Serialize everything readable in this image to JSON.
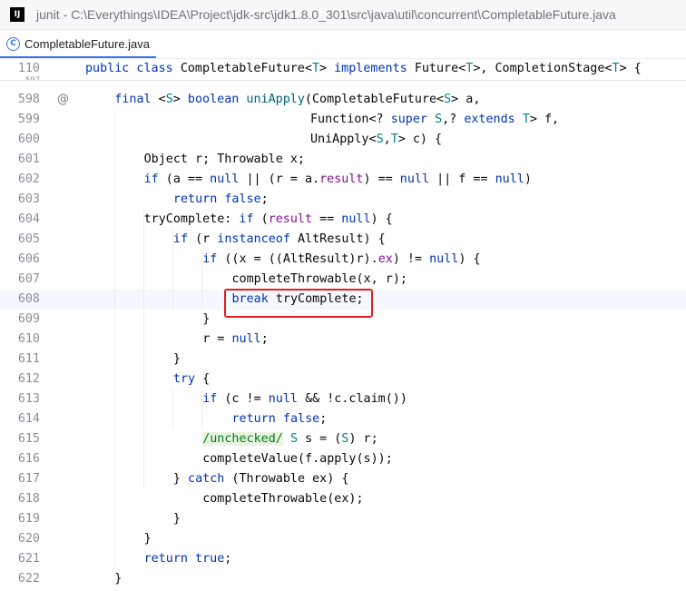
{
  "window": {
    "app_icon_text": "IJ",
    "title": "junit - C:\\Everythings\\IDEA\\Project\\jdk-src\\jdk1.8.0_301\\src\\java\\util\\concurrent\\CompletableFuture.java"
  },
  "tab": {
    "icon_text": "C",
    "label": "CompletableFuture.java"
  },
  "sticky_header": {
    "line_number": "110",
    "cut_line_number": "597",
    "tokens": [
      {
        "t": "public class ",
        "c": "kw"
      },
      {
        "t": "CompletableFuture<",
        "c": ""
      },
      {
        "t": "T",
        "c": "tp"
      },
      {
        "t": "> ",
        "c": ""
      },
      {
        "t": "implements ",
        "c": "kw"
      },
      {
        "t": "Future<",
        "c": ""
      },
      {
        "t": "T",
        "c": "tp"
      },
      {
        "t": ">, CompletionStage<",
        "c": ""
      },
      {
        "t": "T",
        "c": "tp"
      },
      {
        "t": "> {",
        "c": ""
      }
    ]
  },
  "gutter": {
    "annotation_icon": "@",
    "annotation_line": "598"
  },
  "lines": [
    {
      "num": "598",
      "indent": 1,
      "tokens": [
        {
          "t": "final ",
          "c": "kw"
        },
        {
          "t": "<",
          "c": ""
        },
        {
          "t": "S",
          "c": "tp"
        },
        {
          "t": "> ",
          "c": ""
        },
        {
          "t": "boolean ",
          "c": "kw"
        },
        {
          "t": "uniApply",
          "c": "fn"
        },
        {
          "t": "(CompletableFuture<",
          "c": ""
        },
        {
          "t": "S",
          "c": "tp"
        },
        {
          "t": "> a,",
          "c": ""
        }
      ]
    },
    {
      "num": "599",
      "indent": 0,
      "pad": 342,
      "tokens": [
        {
          "t": "Function<? ",
          "c": ""
        },
        {
          "t": "super ",
          "c": "kw"
        },
        {
          "t": "S",
          "c": "tp"
        },
        {
          "t": ",? ",
          "c": ""
        },
        {
          "t": "extends ",
          "c": "kw"
        },
        {
          "t": "T",
          "c": "tp"
        },
        {
          "t": "> f,",
          "c": ""
        }
      ]
    },
    {
      "num": "600",
      "indent": 0,
      "pad": 342,
      "tokens": [
        {
          "t": "UniApply<",
          "c": ""
        },
        {
          "t": "S",
          "c": "tp"
        },
        {
          "t": ",",
          "c": ""
        },
        {
          "t": "T",
          "c": "tp"
        },
        {
          "t": "> c) {",
          "c": ""
        }
      ]
    },
    {
      "num": "601",
      "indent": 2,
      "tokens": [
        {
          "t": "Object r; Throwable x;",
          "c": ""
        }
      ]
    },
    {
      "num": "602",
      "indent": 2,
      "tokens": [
        {
          "t": "if ",
          "c": "kw"
        },
        {
          "t": "(a == ",
          "c": ""
        },
        {
          "t": "null ",
          "c": "kw"
        },
        {
          "t": "|| (r = a.",
          "c": ""
        },
        {
          "t": "result",
          "c": "fld"
        },
        {
          "t": ") == ",
          "c": ""
        },
        {
          "t": "null ",
          "c": "kw"
        },
        {
          "t": "|| f == ",
          "c": ""
        },
        {
          "t": "null",
          "c": "kw"
        },
        {
          "t": ")",
          "c": ""
        }
      ]
    },
    {
      "num": "603",
      "indent": 3,
      "tokens": [
        {
          "t": "return false",
          "c": "kw"
        },
        {
          "t": ";",
          "c": ""
        }
      ]
    },
    {
      "num": "604",
      "indent": 2,
      "tokens": [
        {
          "t": "tryComplete: ",
          "c": ""
        },
        {
          "t": "if ",
          "c": "kw"
        },
        {
          "t": "(",
          "c": ""
        },
        {
          "t": "result",
          "c": "fld"
        },
        {
          "t": " == ",
          "c": ""
        },
        {
          "t": "null",
          "c": "kw"
        },
        {
          "t": ") {",
          "c": ""
        }
      ]
    },
    {
      "num": "605",
      "indent": 3,
      "tokens": [
        {
          "t": "if ",
          "c": "kw"
        },
        {
          "t": "(r ",
          "c": ""
        },
        {
          "t": "instanceof ",
          "c": "kw"
        },
        {
          "t": "AltResult) {",
          "c": ""
        }
      ]
    },
    {
      "num": "606",
      "indent": 4,
      "tokens": [
        {
          "t": "if ",
          "c": "kw"
        },
        {
          "t": "((x = ((AltResult)r).",
          "c": ""
        },
        {
          "t": "ex",
          "c": "fld"
        },
        {
          "t": ") != ",
          "c": ""
        },
        {
          "t": "null",
          "c": "kw"
        },
        {
          "t": ") {",
          "c": ""
        }
      ]
    },
    {
      "num": "607",
      "indent": 5,
      "tokens": [
        {
          "t": "completeThrowable(x, r);",
          "c": ""
        }
      ]
    },
    {
      "num": "608",
      "indent": 5,
      "current": true,
      "tokens": [
        {
          "t": "break ",
          "c": "kw"
        },
        {
          "t": "tryComplete;",
          "c": ""
        }
      ]
    },
    {
      "num": "609",
      "indent": 4,
      "tokens": [
        {
          "t": "}",
          "c": ""
        }
      ]
    },
    {
      "num": "610",
      "indent": 4,
      "tokens": [
        {
          "t": "r = ",
          "c": ""
        },
        {
          "t": "null",
          "c": "kw"
        },
        {
          "t": ";",
          "c": ""
        }
      ]
    },
    {
      "num": "611",
      "indent": 3,
      "tokens": [
        {
          "t": "}",
          "c": ""
        }
      ]
    },
    {
      "num": "612",
      "indent": 3,
      "tokens": [
        {
          "t": "try ",
          "c": "kw"
        },
        {
          "t": "{",
          "c": ""
        }
      ]
    },
    {
      "num": "613",
      "indent": 4,
      "tokens": [
        {
          "t": "if ",
          "c": "kw"
        },
        {
          "t": "(c != ",
          "c": ""
        },
        {
          "t": "null ",
          "c": "kw"
        },
        {
          "t": "&& !c.claim())",
          "c": ""
        }
      ]
    },
    {
      "num": "614",
      "indent": 5,
      "tokens": [
        {
          "t": "return false",
          "c": "kw"
        },
        {
          "t": ";",
          "c": ""
        }
      ]
    },
    {
      "num": "615",
      "indent": 4,
      "tokens": [
        {
          "t": "/unchecked/",
          "c": "comment-hl"
        },
        {
          "t": " ",
          "c": ""
        },
        {
          "t": "S",
          "c": "tp"
        },
        {
          "t": " s = (",
          "c": ""
        },
        {
          "t": "S",
          "c": "tp"
        },
        {
          "t": ") r;",
          "c": ""
        }
      ]
    },
    {
      "num": "616",
      "indent": 4,
      "tokens": [
        {
          "t": "completeValue(f.apply(s));",
          "c": ""
        }
      ]
    },
    {
      "num": "617",
      "indent": 3,
      "tokens": [
        {
          "t": "} ",
          "c": ""
        },
        {
          "t": "catch ",
          "c": "kw"
        },
        {
          "t": "(Throwable ex) {",
          "c": ""
        }
      ]
    },
    {
      "num": "618",
      "indent": 4,
      "tokens": [
        {
          "t": "completeThrowable(ex);",
          "c": ""
        }
      ]
    },
    {
      "num": "619",
      "indent": 3,
      "tokens": [
        {
          "t": "}",
          "c": ""
        }
      ]
    },
    {
      "num": "620",
      "indent": 2,
      "tokens": [
        {
          "t": "}",
          "c": ""
        }
      ]
    },
    {
      "num": "621",
      "indent": 2,
      "tokens": [
        {
          "t": "return true",
          "c": "kw"
        },
        {
          "t": ";",
          "c": ""
        }
      ]
    },
    {
      "num": "622",
      "indent": 1,
      "tokens": [
        {
          "t": "}",
          "c": ""
        }
      ]
    }
  ]
}
